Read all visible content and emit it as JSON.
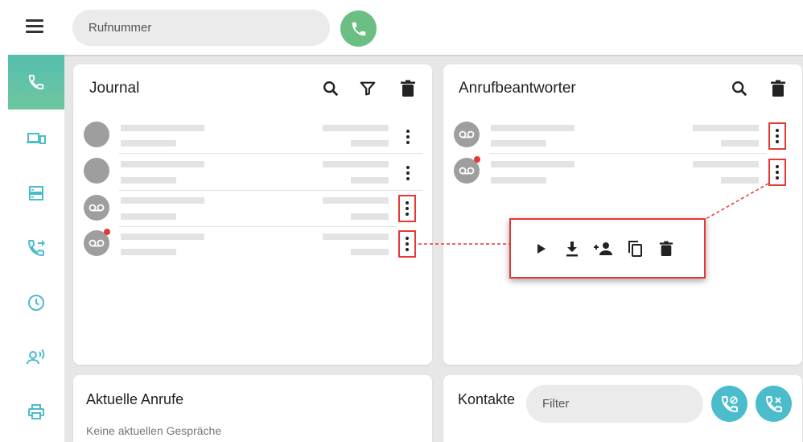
{
  "topbar": {
    "menu_icon": "hamburger-menu-icon",
    "dial_placeholder": "Rufnummer",
    "call_icon": "phone-icon",
    "call_color": "#6bbf85"
  },
  "sidebar": {
    "accent": "#5fc3a8",
    "items": [
      {
        "name": "calls",
        "icon": "phone-icon",
        "active": true
      },
      {
        "name": "devices",
        "icon": "devices-icon",
        "active": false
      },
      {
        "name": "storage",
        "icon": "storage-icon",
        "active": false
      },
      {
        "name": "forwarding",
        "icon": "call-forward-icon",
        "active": false
      },
      {
        "name": "schedule",
        "icon": "clock-icon",
        "active": false
      },
      {
        "name": "announcements",
        "icon": "person-voice-icon",
        "active": false
      },
      {
        "name": "fax",
        "icon": "printer-icon",
        "active": false
      }
    ]
  },
  "journal": {
    "title": "Journal",
    "actions": [
      "search-icon",
      "filter-icon",
      "delete-icon"
    ],
    "rows": [
      {
        "type": "call",
        "missed": false
      },
      {
        "type": "call",
        "missed": false
      },
      {
        "type": "voicemail",
        "missed": false
      },
      {
        "type": "voicemail",
        "missed": true
      }
    ]
  },
  "answering_machine": {
    "title": "Anrufbeantworter",
    "actions": [
      "search-icon",
      "delete-icon"
    ],
    "rows": [
      {
        "type": "voicemail",
        "missed": false
      },
      {
        "type": "voicemail",
        "missed": true
      }
    ]
  },
  "context_menu": {
    "actions": [
      "play-icon",
      "download-icon",
      "add-contact-icon",
      "copy-icon",
      "delete-icon"
    ],
    "highlight_color": "#e53935"
  },
  "current_calls": {
    "title": "Aktuelle Anrufe",
    "empty_text": "Keine aktuellen Gespräche"
  },
  "contacts": {
    "title": "Kontakte",
    "filter_placeholder": "Filter",
    "buttons": [
      "call-block-icon",
      "call-cancel-icon"
    ],
    "button_color": "#4bbccc"
  }
}
